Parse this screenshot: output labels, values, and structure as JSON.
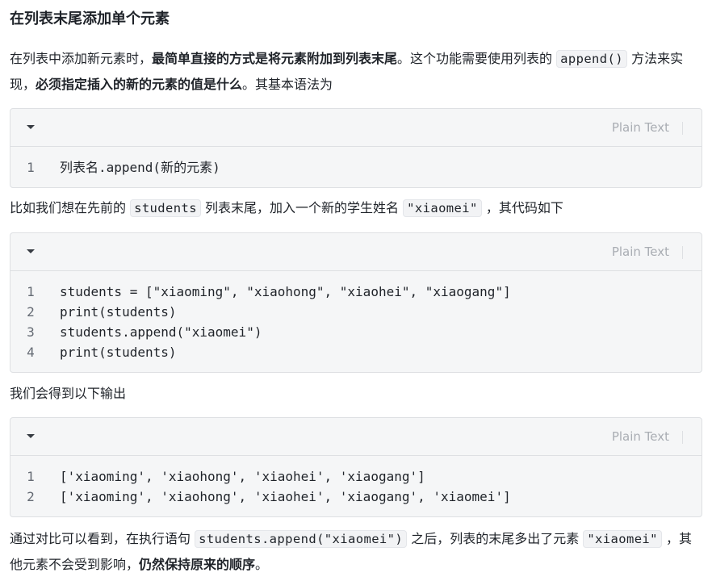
{
  "heading": "在列表末尾添加单个元素",
  "p1": {
    "t1": "在列表中添加新元素时，",
    "b1": "最简单直接的方式是将元素附加到列表末尾",
    "t2": "。这个功能需要使用列表的 ",
    "c1": "append()",
    "t3": " 方法来实现，",
    "b2": "必须指定插入的新的元素的值是什么",
    "t4": "。其基本语法为"
  },
  "code1": {
    "lang": "Plain Text",
    "lines": [
      {
        "n": "1",
        "text": "列表名.append(新的元素)"
      }
    ]
  },
  "p2": {
    "t1": "比如我们想在先前的 ",
    "c1": "students",
    "t2": " 列表末尾，加入一个新的学生姓名 ",
    "c2": "\"xiaomei\"",
    "t3": " ，其代码如下"
  },
  "code2": {
    "lang": "Plain Text",
    "lines": [
      {
        "n": "1",
        "text": "students = [\"xiaoming\", \"xiaohong\", \"xiaohei\", \"xiaogang\"]"
      },
      {
        "n": "2",
        "text": "print(students)"
      },
      {
        "n": "3",
        "text": "students.append(\"xiaomei\")"
      },
      {
        "n": "4",
        "text": "print(students)"
      }
    ]
  },
  "p3": {
    "t1": "我们会得到以下输出"
  },
  "code3": {
    "lang": "Plain Text",
    "lines": [
      {
        "n": "1",
        "text": "['xiaoming', 'xiaohong', 'xiaohei', 'xiaogang']"
      },
      {
        "n": "2",
        "text": "['xiaoming', 'xiaohong', 'xiaohei', 'xiaogang', 'xiaomei']"
      }
    ]
  },
  "p4": {
    "t1": "通过对比可以看到，在执行语句 ",
    "c1": "students.append(\"xiaomei\")",
    "t2": " 之后，列表的末尾多出了元素 ",
    "c2": "\"xiaomei\"",
    "t3": " ，其他元素不会受到影响，",
    "b1": "仍然保持原来的顺序",
    "t4": "。"
  }
}
